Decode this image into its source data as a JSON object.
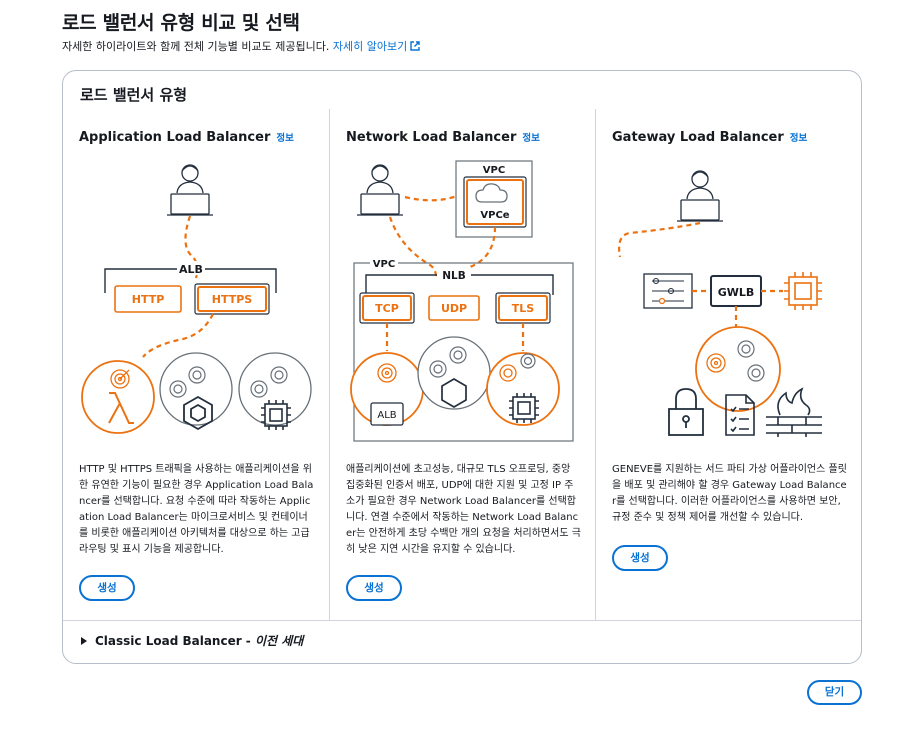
{
  "header": {
    "title": "로드 밸런서 유형 비교 및 선택",
    "subtitle": "자세한 하이라이트와 함께 전체 기능별 비교도 제공됩니다.",
    "learn_more": "자세히 알아보기"
  },
  "panel": {
    "title": "로드 밸런서 유형"
  },
  "alb": {
    "title": "Application Load Balancer",
    "info": "정보",
    "diagram": {
      "group": "ALB",
      "listener1": "HTTP",
      "listener2": "HTTPS"
    },
    "description": "HTTP 및 HTTPS 트래픽을 사용하는 애플리케이션을 위한 유연한 기능이 필요한 경우 Application Load Balancer를 선택합니다. 요청 수준에 따라 작동하는 Application Load Balancer는 마이크로서비스 및 컨테이너를 비롯한 애플리케이션 아키텍처를 대상으로 하는 고급 라우팅 및 표시 기능을 제공합니다.",
    "create": "생성"
  },
  "nlb": {
    "title": "Network Load Balancer",
    "info": "정보",
    "diagram": {
      "vpc_top": "VPC",
      "vpce": "VPCe",
      "vpc_left": "VPC",
      "nlb": "NLB",
      "listener1": "TCP",
      "listener2": "UDP",
      "listener3": "TLS",
      "alb_target": "ALB"
    },
    "description": "애플리케이션에 초고성능, 대규모 TLS 오프로딩, 중앙 집중화된 인증서 배포, UDP에 대한 지원 및 고정 IP 주소가 필요한 경우 Network Load Balancer를 선택합니다. 연결 수준에서 작동하는 Network Load Balancer는 안전하게 초당 수백만 개의 요청을 처리하면서도 극히 낮은 지연 시간을 유지할 수 있습니다.",
    "create": "생성"
  },
  "gwlb": {
    "title": "Gateway Load Balancer",
    "info": "정보",
    "diagram": {
      "gwlb": "GWLB"
    },
    "description": "GENEVE를 지원하는 서드 파티 가상 어플라이언스 플릿을 배포 및 관리해야 할 경우 Gateway Load Balancer를 선택합니다. 이러한 어플라이언스를 사용하면 보안, 규정 준수 및 정책 제어를 개선할 수 있습니다.",
    "create": "생성"
  },
  "classic": {
    "label": "Classic Load Balancer - ",
    "suffix": "이전 세대"
  },
  "footer": {
    "close": "닫기"
  },
  "colors": {
    "accent": "#0972d3",
    "orange": "#ec7211",
    "text": "#16191f",
    "border": "#b6bec9"
  }
}
